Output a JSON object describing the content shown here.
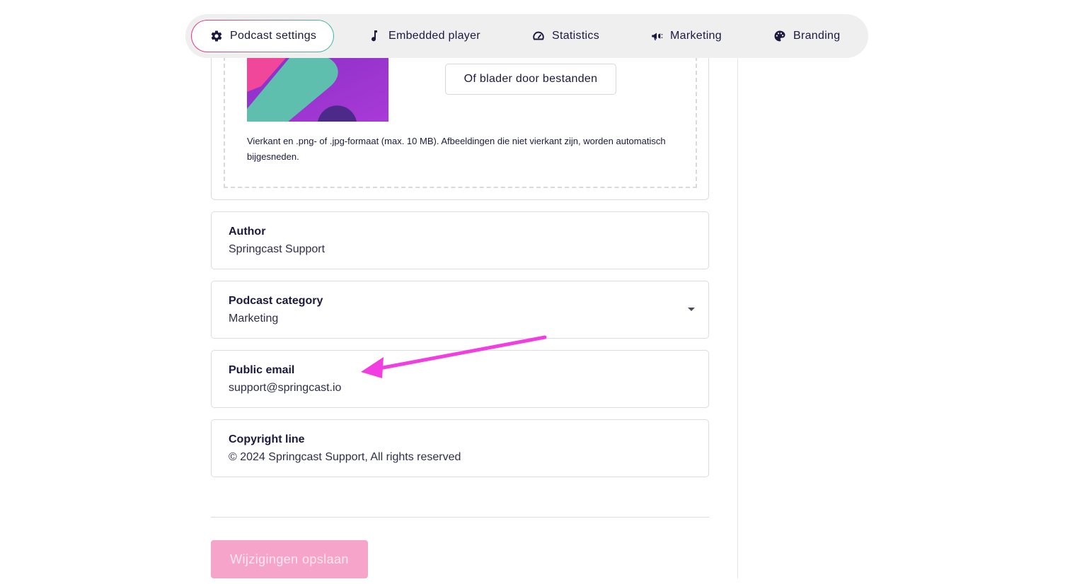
{
  "tabs": [
    {
      "label": "Podcast settings",
      "icon": "gear-icon",
      "active": true
    },
    {
      "label": "Embedded player",
      "icon": "music-note-icon",
      "active": false
    },
    {
      "label": "Statistics",
      "icon": "speedometer-icon",
      "active": false
    },
    {
      "label": "Marketing",
      "icon": "megaphone-icon",
      "active": false
    },
    {
      "label": "Branding",
      "icon": "palette-icon",
      "active": false
    }
  ],
  "upload": {
    "browse_label": "Of blader door bestanden",
    "help_text": "Vierkant en .png- of .jpg-formaat (max. 10 MB). Afbeeldingen die niet vierkant zijn, worden automatisch bijgesneden."
  },
  "fields": {
    "author": {
      "label": "Author",
      "value": "Springcast Support"
    },
    "category": {
      "label": "Podcast category",
      "value": "Marketing"
    },
    "email": {
      "label": "Public email",
      "value": "support@springcast.io"
    },
    "copyright": {
      "label": "Copyright line",
      "value": "© 2024 Springcast Support, All rights reserved"
    }
  },
  "save_label": "Wijzigingen opslaan",
  "colors": {
    "accent_pink": "#e6368a",
    "accent_teal": "#3cc0a6",
    "save_button_bg": "#f6a4c9",
    "annotation_arrow": "#f23ee0"
  }
}
